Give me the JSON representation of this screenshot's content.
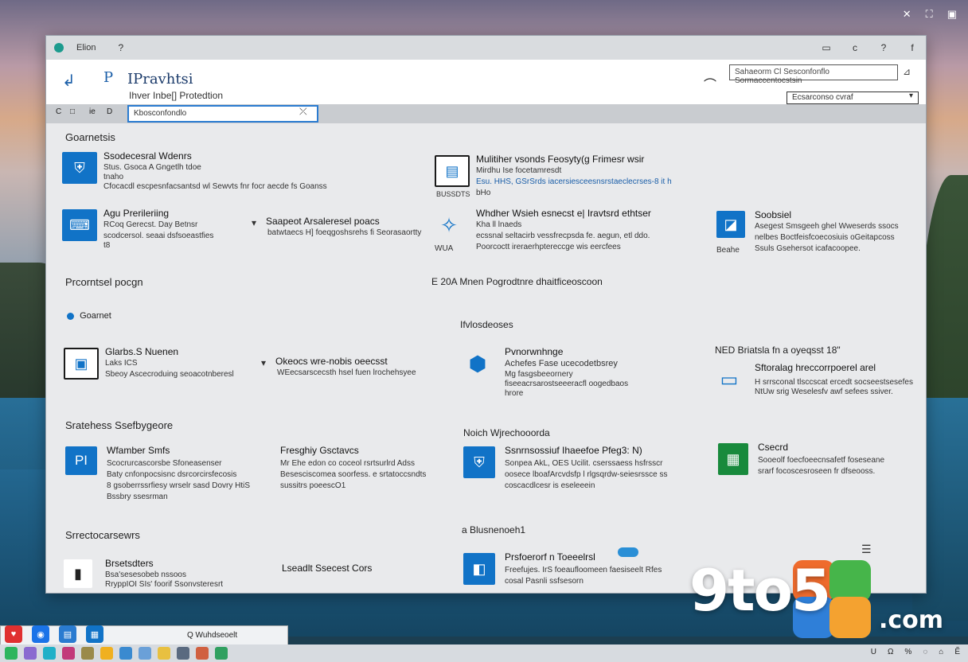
{
  "window": {
    "title": "Elion",
    "help_icon": "?",
    "controls": [
      "▭",
      "c",
      "?",
      "f"
    ]
  },
  "header": {
    "logo_glyph": "P",
    "title": "IPravhtsi",
    "subtitle": "Ihver Inbe[] Protedtion",
    "search_value": "Sahaeorm Cl Sesconfonflo Sormaccentocstsin",
    "filter_value": "Ecsarconso cvraf"
  },
  "toolbar": {
    "buttons": [
      "C",
      "□",
      "ie",
      "D"
    ],
    "search_value": "Kbosconfondlo"
  },
  "sections": {
    "s1": "Goarnetsis",
    "s2": "Prcorntsel pocgn",
    "s3": "Sratehess Ssefbygeore",
    "s4": "Srrectocarsewrs",
    "s5": "E 20A Mnen Pogrodtnre dhaitficeoscoon",
    "s6": "Ifvlosdeoses",
    "s7": "Noich Wjrechooorda",
    "s8": "a Blusnenoeh1",
    "s9": "NED Briatsla fn a oyeqsst 18\""
  },
  "radio": {
    "label": "Goarnet"
  },
  "cards": [
    {
      "title": "Ssodecesral Wdenrs",
      "lines": [
        "Stus. Gsoca A Gngetlh tdoe",
        "tnaho",
        "Cfocacdl escpesnfacsantsd wl Sewvts fnr focr aecde fs Goanss"
      ]
    },
    {
      "title": "Mulitiher vsonds Feosyty(g Frimesr wsir",
      "lines": [
        "Mirdhu Ise focetamresdt",
        "Esu. HHS, GSrSrds iacersiesceesnsrstaeclecrses-8 it h",
        "bHo"
      ],
      "badge": "BUSSDTS"
    },
    {
      "title": "Agu Prerileriing",
      "lines": [
        "RCoq Gerecst. Day Betnsr",
        "scodcersol. seaai dsfsoeastfies",
        "t8"
      ]
    },
    {
      "title": "Saapeot Arsaleresel poacs",
      "lines": [
        "batwtaecs H] foeqgoshsrehs fi Seorasaortty"
      ]
    },
    {
      "title": "Whdher Wsieh esnecst e| Iravtsrd ethtser",
      "lines": [
        "Kha ll lnaeds",
        "ecssnal seltacirb vessfrecpsda fe. aegun, etl ddo.",
        "Poorcoctt ireraerhptereccge wis eercfees"
      ],
      "badge": "WUA"
    },
    {
      "title": "Soobsiel",
      "lines": [
        "Asegest Smsgeeh ghel Wweserds ssocs",
        "nelbes Boctfeisfcoecosiuis oGeitapcoss",
        "Ssuls Gsehersot icafacoopee."
      ],
      "badge": "Beahe"
    },
    {
      "title": "Glarbs.S Nuenen",
      "lines": [
        "Laks ICS",
        "Sbeoy Ascecroduing seoacotnberesl"
      ]
    },
    {
      "title": "Okeocs wre-nobis oeecsst",
      "lines": [
        "WEecsarscecsth hsel fuen lrochehsyee"
      ]
    },
    {
      "title": "Pvnorwnhnge",
      "lines": [
        "Achefes Fase ucecodetbsrey",
        "Mg fasgsbeeornery",
        "fiseeacrsarostseeeracfl oogedbaos",
        "hrore"
      ]
    },
    {
      "title": "Sftoralag hreccorrpoerel arel",
      "lines": [
        "H srrsconal tlsccscat ercedt socseestsesefes",
        "NtUw srig Weselesfv awf sefees ssiver."
      ]
    },
    {
      "title": "Wfamber Smfs",
      "lines": [
        "Scocrurcascorsbe Sfoneasenser",
        "Baty cnfonpocsisnc dsrcorcirsfecosis",
        "8 gsoberrssrfiesy wrselr sasd Dovry HtiS",
        "Bssbry ssesrman"
      ]
    },
    {
      "title": "Fresghiy Gsctavcs",
      "lines": [
        "Mr Ehe edon co coceol rsrtsurlrd Adss",
        "Besesciscomea soorfess. e srtatoccsndts",
        "sussitrs poeescO1"
      ]
    },
    {
      "title": "Ssnrnsossiuf Ihaeefoe Pfeg3: N)",
      "lines": [
        "Sonpea AkL, OES Ucilit. cserssaess hsfrsscr",
        "oosece lboafArcvdsfp l rlgsqrdw-seiesrssce ss",
        "coscacdlcesr is eseleeein"
      ]
    },
    {
      "title": "Csecrd",
      "lines": [
        "Sooeolf foecfoeecnsafetf foseseane",
        "srarf focoscesroseen fr dfseooss."
      ]
    },
    {
      "title": "Brsetsdters",
      "lines": [
        "Bsa'sesesobeb nssoos",
        "RryppIOI SIs' foorif Ssonvsteresrt"
      ]
    },
    {
      "title": "Lseadlt Ssecest Cors",
      "lines": []
    },
    {
      "title": "Prsfoerorf n Toeeelrsl",
      "lines": [
        "Freefujes. IrS foeaufloomeen faesiseelt Rfes",
        "cosal Pasnli ssfsesorn"
      ]
    }
  ],
  "start_popup": {
    "label": "Q Wuhdseoelt"
  },
  "tray": [
    "U",
    "Ω",
    "%",
    "◌",
    "⌂",
    "Ẽ"
  ],
  "watermark": {
    "text": "9to5",
    "suffix": ".com"
  },
  "colors": {
    "accent": "#1173c7",
    "green": "#188a3c",
    "window_bg": "#e9eaec"
  }
}
